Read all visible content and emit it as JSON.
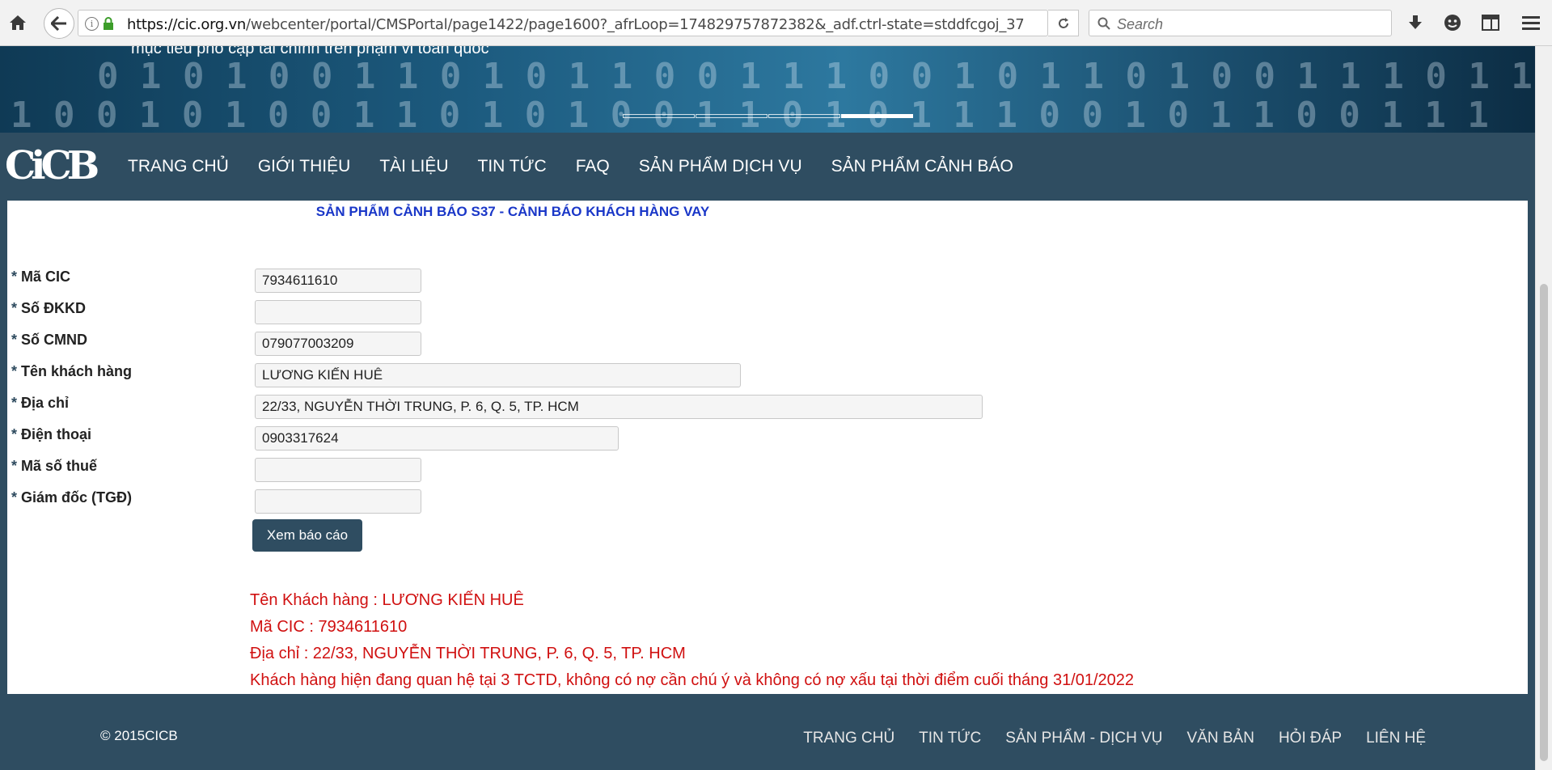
{
  "browser": {
    "url_host": "https://cic.org.vn",
    "url_path": "/webcenter/portal/CMSPortal/page1422/page1600?_afrLoop=174829757872382&_adf.ctrl-state=stddfcgoj_37",
    "search_placeholder": "Search"
  },
  "banner": {
    "tagline": "mục tiêu phổ cập tài chính trên phạm vi toàn quốc",
    "slide_count": 4,
    "active_slide": 4
  },
  "nav": {
    "logo": "CiCB",
    "items": [
      "TRANG CHỦ",
      "GIỚI THIỆU",
      "TÀI LIỆU",
      "TIN TỨC",
      "FAQ",
      "SẢN PHẨM DỊCH VỤ",
      "SẢN PHẨM CẢNH BÁO"
    ]
  },
  "page": {
    "title": "SẢN PHẨM CẢNH BÁO S37 - CẢNH BÁO KHÁCH HÀNG VAY",
    "required_marker": "*",
    "fields": [
      {
        "label": "Mã CIC",
        "value": "7934611610"
      },
      {
        "label": "Số ĐKKD",
        "value": ""
      },
      {
        "label": "Số CMND",
        "value": "079077003209"
      },
      {
        "label": "Tên khách hàng",
        "value": "LƯƠNG KIẾN HUÊ"
      },
      {
        "label": "Địa chỉ",
        "value": "22/33, NGUYỄN THỜI TRUNG, P. 6, Q. 5, TP. HCM"
      },
      {
        "label": "Điện thoại",
        "value": "0903317624"
      },
      {
        "label": "Mã số thuế",
        "value": ""
      },
      {
        "label": "Giám đốc (TGĐ)",
        "value": ""
      }
    ],
    "submit_label": "Xem báo cáo",
    "results": [
      "Tên Khách hàng : LƯƠNG KIẾN HUÊ",
      "Mã CIC : 7934611610",
      "Địa chỉ : 22/33, NGUYỄN THỜI TRUNG, P. 6, Q. 5, TP. HCM",
      "Khách hàng hiện đang quan hệ tại 3 TCTD, không có nợ cần chú ý và không có nợ xấu tại thời điểm cuối tháng 31/01/2022"
    ]
  },
  "footer": {
    "copyright": "© 2015CICB",
    "links": [
      "TRANG CHỦ",
      "TIN TỨC",
      "SẢN PHẨM - DỊCH VỤ",
      "VĂN BẢN",
      "HỎI ĐÁP",
      "LIÊN HỆ"
    ]
  },
  "colors": {
    "nav_bg": "#2f4d61",
    "title": "#1a37c8",
    "result_text": "#d01010"
  }
}
